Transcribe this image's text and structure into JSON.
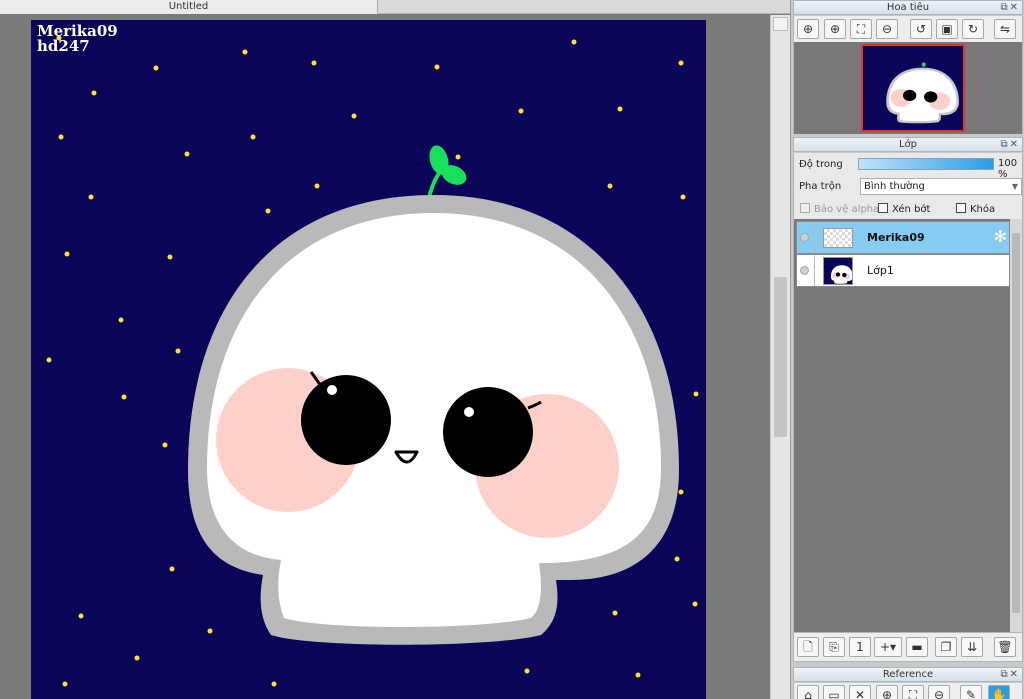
{
  "document": {
    "tab_title": "Untitled"
  },
  "canvas": {
    "background_color": "#0a0559",
    "watermark_line1": "Merika09",
    "watermark_line2": "hd247"
  },
  "navigator": {
    "title": "Hoa tiêu",
    "tools": [
      "zoom-in-icon",
      "zoom-in-plus-icon",
      "fit-icon",
      "zoom-out-icon",
      "rotate-left-icon",
      "actual-size-icon",
      "rotate-right-icon",
      "flip-icon"
    ]
  },
  "layers_panel": {
    "title": "Lớp",
    "opacity_label": "Độ trong",
    "opacity_value": "100 %",
    "blend_label": "Pha trộn",
    "blend_value": "Bình thường",
    "protect_alpha_label": "Bảo vệ alpha",
    "clipping_label": "Xén bớt",
    "lock_label": "Khóa",
    "layers": [
      {
        "name": "Merika09",
        "active": true
      },
      {
        "name": "Lớp1",
        "active": false
      }
    ],
    "toolbar_tools": [
      "new-layer-icon",
      "new-layer-copy-icon",
      "new-1bit-layer-icon",
      "add-layer-dropdown-icon",
      "new-folder-icon",
      "duplicate-icon",
      "merge-down-icon",
      "delete-icon"
    ]
  },
  "reference_panel": {
    "title": "Reference"
  },
  "colors": {
    "selected_layer": "#86cbf1",
    "accent_red": "#e53030",
    "star_yellow": "#ffe033",
    "sprout_green": "#19e05b",
    "cheek_pink": "#ffcfc9"
  }
}
